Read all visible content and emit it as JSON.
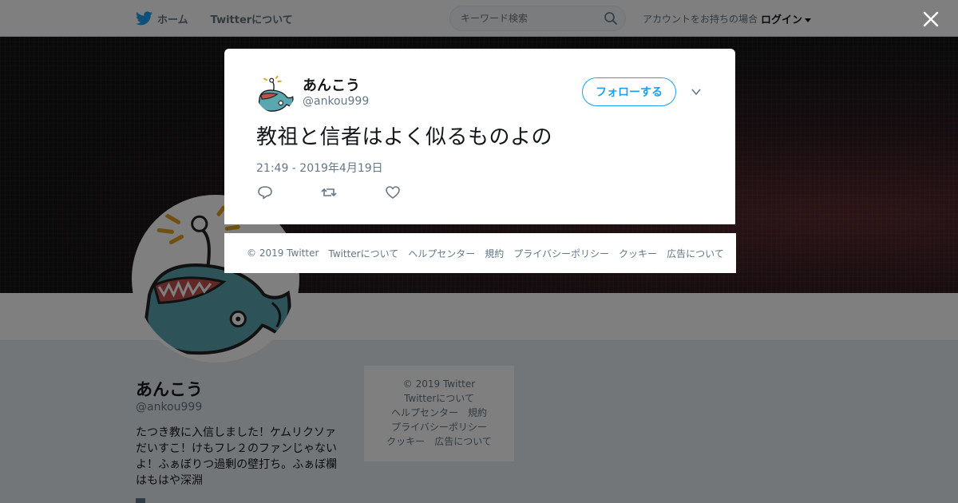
{
  "nav": {
    "home_label": "ホーム",
    "about_label": "Twitterについて",
    "search_placeholder": "キーワード検索",
    "login_prompt": "アカウントをお持ちの場合",
    "login_label": "ログイン"
  },
  "profile": {
    "name": "あんこう",
    "handle": "@ankou999",
    "bio": "たつき教に入信しました！ケムリクソァだいすこ！けもフレ２のファンじゃないよ！ふぁぼりつ過剰の壁打ち。ふぁぼ欄はもはや深淵"
  },
  "side_footer": {
    "copyright": "© 2019 Twitter",
    "about": "Twitterについて",
    "help": "ヘルプセンター",
    "terms": "規約",
    "privacy": "プライバシーポリシー",
    "cookies": "クッキー",
    "ads": "広告について"
  },
  "tweet": {
    "author_name": "あんこう",
    "author_handle": "@ankou999",
    "follow_label": "フォローする",
    "text": "教祖と信者はよく似るものよの",
    "timestamp": "21:49 - 2019年4月19日"
  },
  "modal_footer": {
    "copyright": "© 2019 Twitter",
    "about": "Twitterについて",
    "help": "ヘルプセンター",
    "terms": "規約",
    "privacy": "プライバシーポリシー",
    "cookies": "クッキー",
    "ads": "広告について"
  },
  "icons": {
    "brand": "twitter-bird-icon",
    "search": "search-icon",
    "close": "close-icon",
    "more": "chevron-down-icon",
    "reply": "reply-icon",
    "retweet": "retweet-icon",
    "like": "heart-icon"
  },
  "colors": {
    "accent": "#1da1f2",
    "text_secondary": "#657786",
    "fish": "#5aa7b0"
  }
}
